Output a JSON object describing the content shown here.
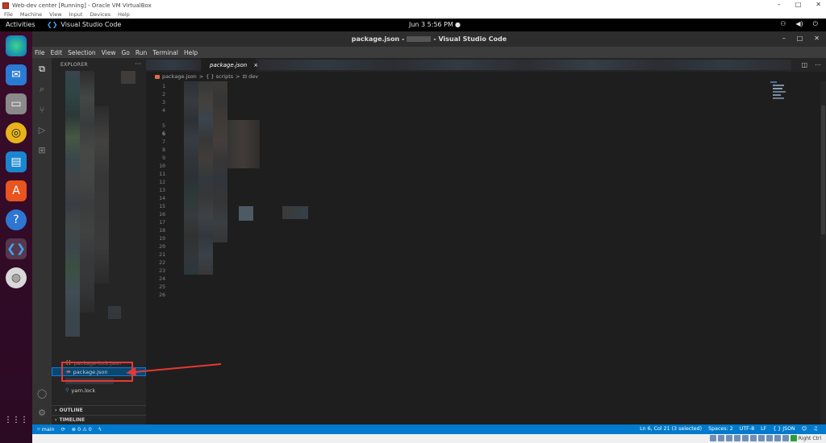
{
  "host_window": {
    "title": "Web-dev center [Running] - Oracle VM VirtualBox",
    "menu": [
      "File",
      "Machine",
      "View",
      "Input",
      "Devices",
      "Help"
    ],
    "controls": [
      "–",
      "□",
      "✕"
    ],
    "status_right": "Right Ctrl"
  },
  "ubuntu": {
    "activities": "Activities",
    "app_name": "Visual Studio Code",
    "clock": "Jun 3  5:56 PM",
    "dock_items": [
      {
        "name": "edge-icon",
        "glyph": "◉"
      },
      {
        "name": "thunderbird-icon",
        "glyph": "✉"
      },
      {
        "name": "files-icon",
        "glyph": "▭"
      },
      {
        "name": "rhythmbox-icon",
        "glyph": "◎"
      },
      {
        "name": "writer-icon",
        "glyph": "▤"
      },
      {
        "name": "software-icon",
        "glyph": "A"
      },
      {
        "name": "help-icon",
        "glyph": "?"
      },
      {
        "name": "vscode-icon",
        "glyph": "❮❯"
      },
      {
        "name": "dvd-icon",
        "glyph": "◍"
      }
    ],
    "show_apps_glyph": "⋮⋮⋮"
  },
  "vscode": {
    "title_prefix": "package.json -",
    "title_suffix": "- Visual Studio Code",
    "menu": [
      "File",
      "Edit",
      "Selection",
      "View",
      "Go",
      "Run",
      "Terminal",
      "Help"
    ],
    "explorer_label": "EXPLORER",
    "explorer_more": "···",
    "files": {
      "lock": "package-lock.json",
      "package": "package.json",
      "yarn": "yarn.lock"
    },
    "sections": {
      "outline": "OUTLINE",
      "timeline": "TIMELINE"
    },
    "tab": {
      "label": "package.json",
      "close": "×"
    },
    "breadcrumb": {
      "file": "package.json",
      "sep": ">",
      "scripts": "{ } scripts",
      "dev": "⊟ dev"
    },
    "line_numbers": [
      "1",
      "2",
      "3",
      "4",
      "5",
      "6",
      "7",
      "8",
      "9",
      "10",
      "11",
      "12",
      "13",
      "14",
      "15",
      "16",
      "17",
      "18",
      "19",
      "20",
      "21",
      "22",
      "23",
      "24",
      "25",
      "26"
    ],
    "current_line": "6",
    "status": {
      "branch": "main",
      "sync": "⟳",
      "problems": "⊗ 0 ⚠ 0",
      "position": "Ln 6, Col 21 (3 selected)",
      "spaces": "Spaces: 2",
      "encoding": "UTF-8",
      "eol": "LF",
      "language": "{ } JSON"
    }
  },
  "colors": {
    "vscode_blue": "#007acc",
    "selection": "#094771",
    "annotation_red": "#e53935"
  }
}
